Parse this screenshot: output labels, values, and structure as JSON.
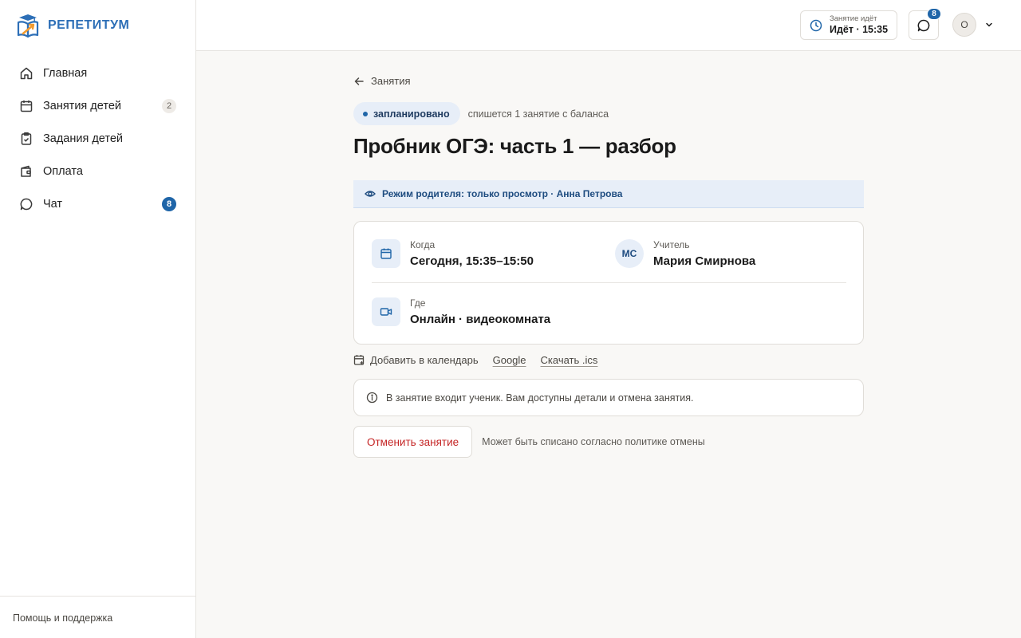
{
  "brand": {
    "name": "РЕПЕТИТУМ",
    "logo_icon": "book-graduation-cap-logo",
    "color": "#2d6fb7"
  },
  "sidebar": {
    "items": [
      {
        "label": "Главная",
        "icon": "home-icon",
        "badge": ""
      },
      {
        "label": "Занятия детей",
        "icon": "calendar-icon",
        "badge": "2"
      },
      {
        "label": "Задания детей",
        "icon": "clipboard-check-icon",
        "badge": ""
      },
      {
        "label": "Оплата",
        "icon": "wallet-icon",
        "badge": ""
      },
      {
        "label": "Чат",
        "icon": "chat-bubble-icon",
        "badge": "8"
      }
    ],
    "footer_link": "Помощь и поддержка"
  },
  "header": {
    "lesson_status": {
      "caption": "Занятие идёт",
      "value": "Идёт · 15:35",
      "icon": "clock-icon"
    },
    "chat": {
      "icon": "chat-bubble-icon",
      "badge": "8"
    },
    "avatar": {
      "initial": "О",
      "icon": "chevron-down-icon"
    }
  },
  "page": {
    "back_label": "Занятия",
    "status": {
      "label": "запланировано",
      "note": "спишется 1 занятие с баланса"
    },
    "title": "Пробник ОГЭ: часть 1 — разбор",
    "parent_banner": "Режим родителя: только просмотр · Анна Петрова",
    "details": {
      "when": {
        "label": "Когда",
        "value": "Сегодня, 15:35–15:50",
        "icon": "calendar-icon"
      },
      "teacher": {
        "label": "Учитель",
        "value": "Мария Смирнова",
        "initials": "МС"
      },
      "where": {
        "label": "Где",
        "value": "Онлайн · видеокомната",
        "icon": "video-camera-icon"
      }
    },
    "calendar": {
      "label": "Добавить в календарь",
      "google": "Google",
      "ics": "Скачать .ics"
    },
    "notice": "В занятие входит ученик. Вам доступны детали и отмена занятия.",
    "cancel": {
      "button": "Отменить занятие",
      "note": "Может быть списано согласно политике отмены"
    }
  },
  "colors": {
    "accent": "#1f65a8",
    "danger": "#c52626",
    "accent_bg": "#e7eef8"
  }
}
